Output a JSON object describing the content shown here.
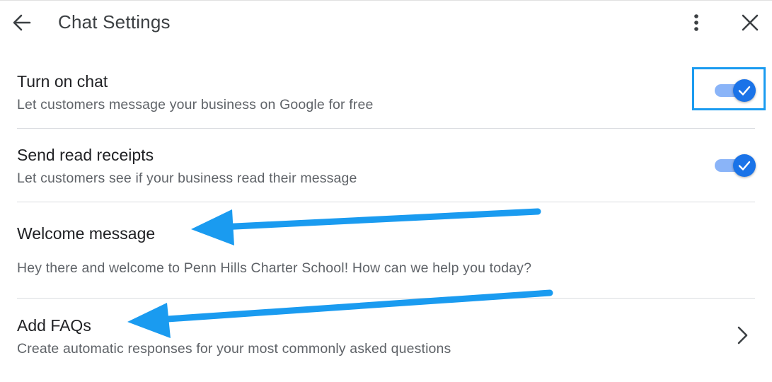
{
  "header": {
    "title": "Chat Settings",
    "back_icon": "arrow-left-icon",
    "more_icon": "more-vert-icon",
    "close_icon": "close-icon"
  },
  "settings": [
    {
      "title": "Turn on chat",
      "subtitle": "Let customers message your business on Google for free",
      "toggle": true,
      "focused": true
    },
    {
      "title": "Send read receipts",
      "subtitle": "Let customers see if your business read their message",
      "toggle": true
    },
    {
      "title": "Welcome message",
      "subtitle": "Hey there and welcome to Penn Hills Charter School! How can we help you today?"
    },
    {
      "title": "Add FAQs",
      "subtitle": "Create automatic responses for your most commonly asked questions",
      "action_icon": "chevron-right-icon"
    }
  ],
  "colors": {
    "accent": "#1a73e8",
    "track": "#8ab4f8",
    "annotation_arrow": "#1a9bf0",
    "divider": "#dadce0"
  }
}
